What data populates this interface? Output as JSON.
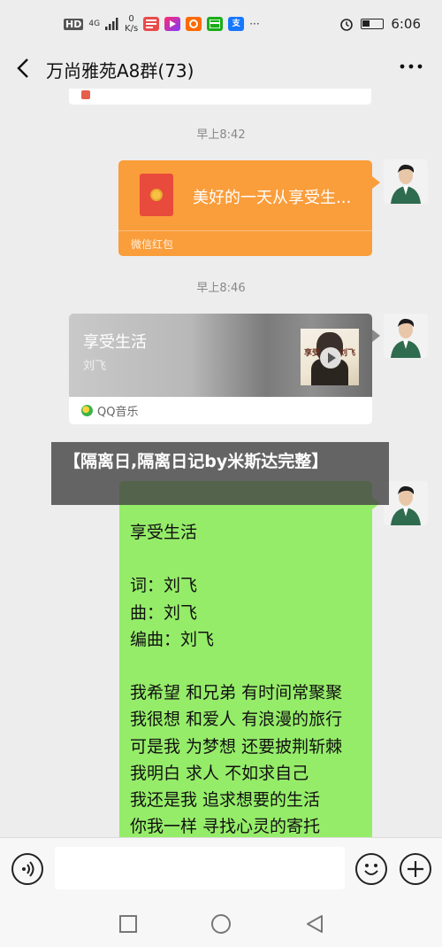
{
  "status_bar": {
    "network_label": "HD",
    "signal_label": "4G",
    "speed_value": "0",
    "speed_unit": "K/s",
    "time": "6:06",
    "more_indicator": "···",
    "app_icons": [
      "news-icon",
      "video-icon",
      "taobao-icon",
      "wechat-pay-icon",
      "alipay-icon"
    ],
    "app_icon_letters": [
      "",
      "",
      "",
      "",
      "支"
    ]
  },
  "header": {
    "title": "万尚雅苑A8群(73)",
    "more_label": "···"
  },
  "chat": {
    "timestamps": [
      "早上8:42",
      "早上8:46"
    ],
    "red_packet": {
      "title": "美好的一天从享受生...",
      "label": "微信红包"
    },
    "music_card": {
      "title": "享受生活",
      "artist": "刘飞",
      "source": "QQ音乐",
      "album_cap_left": "享受",
      "album_cap_right": "刘飞"
    },
    "lyrics_message": "享受生活\n\n词：刘飞\n曲：刘飞\n编曲：刘飞\n\n我希望 和兄弟 有时间常聚聚\n我很想 和爱人 有浪漫的旅行\n可是我 为梦想 还要披荆斩棘\n我明白 求人 不如求自己\n我还是我 追求想要的生活\n你我一样 寻找心灵的寄托"
  },
  "overlay": {
    "text": "【隔离日,隔离日记by米斯达完整】"
  },
  "input_bar": {
    "placeholder": "",
    "value": ""
  },
  "colors": {
    "background": "#ededed",
    "red_packet": "#fa9d3b",
    "sent_bubble": "#95ec69",
    "overlay": "#464646"
  }
}
